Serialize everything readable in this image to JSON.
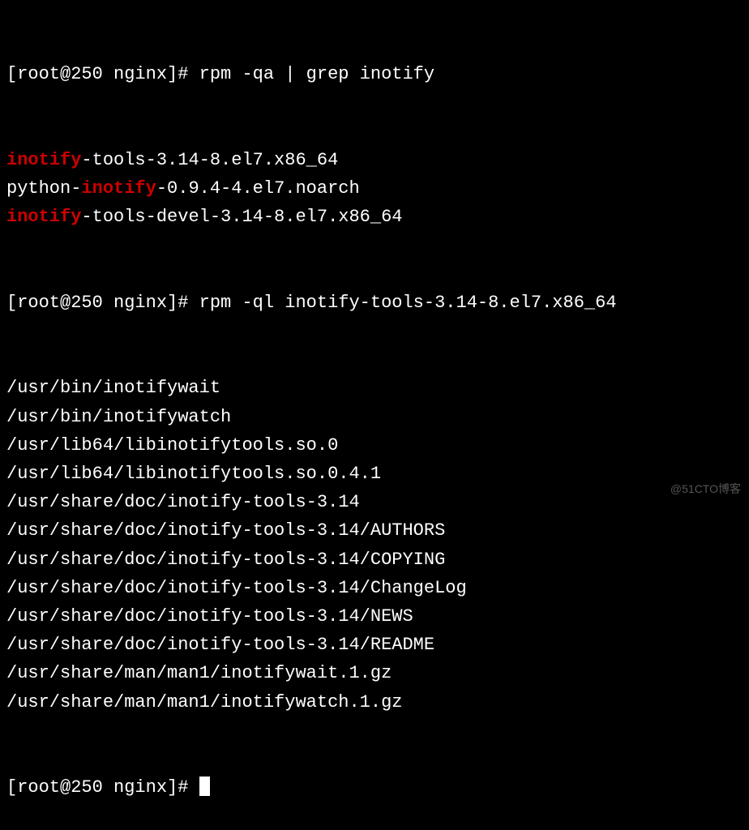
{
  "prompt1": "[root@250 nginx]# ",
  "command1": "rpm -qa | grep inotify",
  "results1": [
    {
      "pre": "",
      "hl": "inotify",
      "post": "-tools-3.14-8.el7.x86_64"
    },
    {
      "pre": "python-",
      "hl": "inotify",
      "post": "-0.9.4-4.el7.noarch"
    },
    {
      "pre": "",
      "hl": "inotify",
      "post": "-tools-devel-3.14-8.el7.x86_64"
    }
  ],
  "prompt2": "[root@250 nginx]# ",
  "command2": "rpm -ql inotify-tools-3.14-8.el7.x86_64",
  "files": [
    "/usr/bin/inotifywait",
    "/usr/bin/inotifywatch",
    "/usr/lib64/libinotifytools.so.0",
    "/usr/lib64/libinotifytools.so.0.4.1",
    "/usr/share/doc/inotify-tools-3.14",
    "/usr/share/doc/inotify-tools-3.14/AUTHORS",
    "/usr/share/doc/inotify-tools-3.14/COPYING",
    "/usr/share/doc/inotify-tools-3.14/ChangeLog",
    "/usr/share/doc/inotify-tools-3.14/NEWS",
    "/usr/share/doc/inotify-tools-3.14/README",
    "/usr/share/man/man1/inotifywait.1.gz",
    "/usr/share/man/man1/inotifywatch.1.gz"
  ],
  "prompt3": "[root@250 nginx]# ",
  "watermark": "@51CTO博客"
}
